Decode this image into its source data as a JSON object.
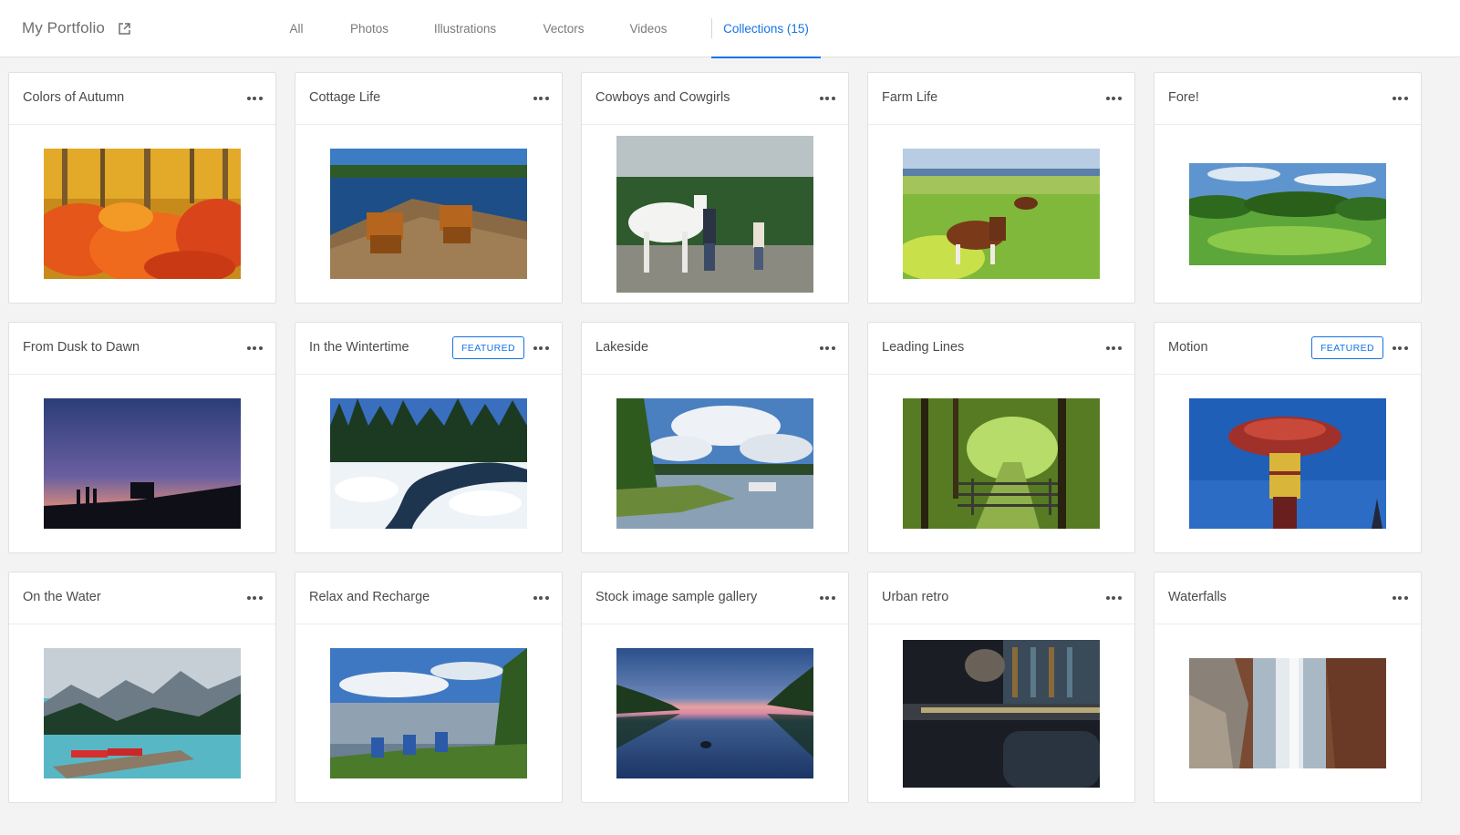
{
  "header": {
    "title": "My Portfolio",
    "external_icon": "external-link-icon",
    "tabs": [
      {
        "label": "All",
        "active": false
      },
      {
        "label": "Photos",
        "active": false
      },
      {
        "label": "Illustrations",
        "active": false
      },
      {
        "label": "Vectors",
        "active": false
      },
      {
        "label": "Videos",
        "active": false
      },
      {
        "label": "Collections (15)",
        "active": true
      }
    ],
    "accent_color": "#1473e6"
  },
  "collections": [
    {
      "title": "Colors of Autumn",
      "featured": false,
      "scene": "autumn-foliage"
    },
    {
      "title": "Cottage Life",
      "featured": false,
      "scene": "dock-chairs-lake"
    },
    {
      "title": "Cowboys and Cowgirls",
      "featured": false,
      "scene": "horse-and-riders"
    },
    {
      "title": "Farm Life",
      "featured": false,
      "scene": "grazing-horses"
    },
    {
      "title": "Fore!",
      "featured": false,
      "scene": "golf-course"
    },
    {
      "title": "From Dusk to Dawn",
      "featured": false,
      "scene": "dusk-silhouettes"
    },
    {
      "title": "In the Wintertime",
      "featured": true,
      "badge": "FEATURED",
      "scene": "snowy-creek"
    },
    {
      "title": "Lakeside",
      "featured": false,
      "scene": "lake-clouds"
    },
    {
      "title": "Leading Lines",
      "featured": false,
      "scene": "forest-fence"
    },
    {
      "title": "Motion",
      "featured": true,
      "badge": "FEATURED",
      "scene": "carnival-ride"
    },
    {
      "title": "On the Water",
      "featured": false,
      "scene": "mountain-lake-canoes"
    },
    {
      "title": "Relax and Recharge",
      "featured": false,
      "scene": "blue-chairs-shore"
    },
    {
      "title": "Stock image sample gallery",
      "featured": false,
      "scene": "sunset-river"
    },
    {
      "title": "Urban retro",
      "featured": false,
      "scene": "retro-interior"
    },
    {
      "title": "Waterfalls",
      "featured": false,
      "scene": "waterfall-rocks"
    }
  ]
}
